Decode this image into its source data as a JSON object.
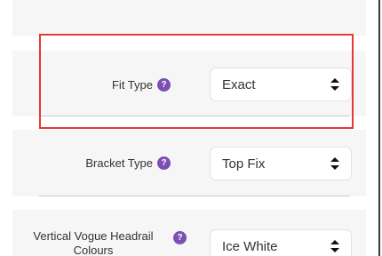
{
  "fit_type": {
    "label": "Fit Type",
    "help": "?",
    "value": "Exact"
  },
  "bracket_type": {
    "label": "Bracket Type",
    "help": "?",
    "value": "Top Fix"
  },
  "headrail_colours": {
    "label": "Vertical Vogue Headrail Colours",
    "help": "?",
    "value": "Ice White"
  },
  "colors": {
    "help_icon": "#7b4fb3",
    "highlight": "#e53935",
    "panel": "#f6f6f6"
  },
  "icons": [
    "help-icon",
    "select-arrows-icon"
  ]
}
